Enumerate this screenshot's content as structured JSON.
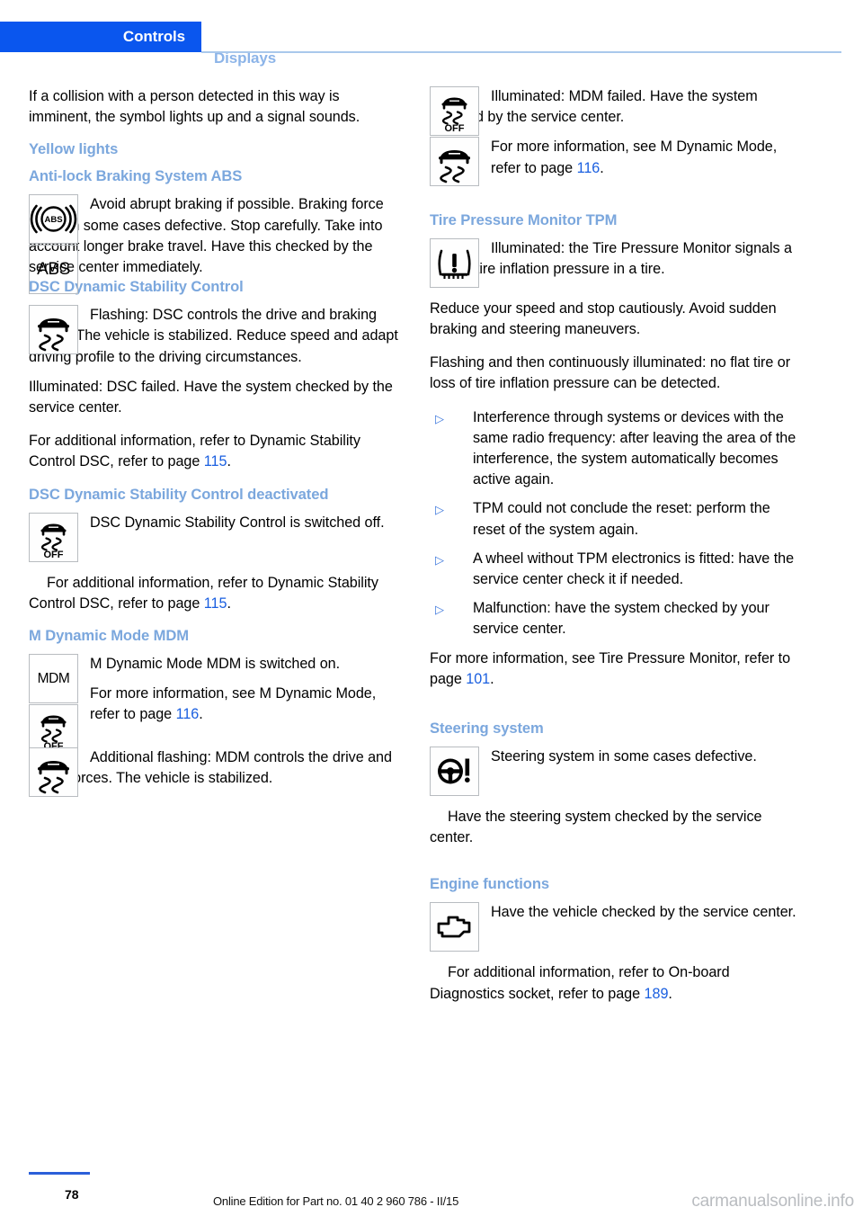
{
  "header": {
    "active_tab": "Controls",
    "inactive_tab": "Displays",
    "accent_blue": "#0a56ee",
    "heading_blue": "#7ba7dd",
    "link_blue": "#1a5fe0"
  },
  "left_column": {
    "intro": "If a collision with a person detected in this way is imminent, the symbol lights up and a signal sounds.",
    "yellow_lights_heading": "Yellow lights",
    "abs": {
      "heading": "Anti-lock Braking System ABS",
      "icon_1": "abs-circle-icon",
      "icon_2_label": "ABS",
      "body": "Avoid abrupt braking if possible. Braking force boost in some cases defective. Stop carefully. Take into account longer brake travel. Have this checked by the service center immediately."
    },
    "dsc": {
      "heading": "DSC Dynamic Stability Control",
      "icon": "car-skid-icon",
      "body_1": "Flashing: DSC controls the drive and braking forces. The vehicle is stabilized. Reduce speed and adapt driving profile to the driving circumstances.",
      "body_2": "Illuminated: DSC failed. Have the system checked by the service center.",
      "body_3_pre": "For additional information, refer to Dynamic Stability Control DSC, refer to page ",
      "body_3_page": "115",
      "body_3_post": "."
    },
    "dsc_off": {
      "heading": "DSC Dynamic Stability Control deactivated",
      "icon": "car-skid-off-icon",
      "body_1": "DSC Dynamic Stability Control is switched off.",
      "body_2_pre": "For additional information, refer to Dynamic Stability Control DSC, refer to page ",
      "body_2_page": "115",
      "body_2_post": "."
    },
    "mdm": {
      "heading": "M Dynamic Mode MDM",
      "icon_1_label": "MDM",
      "icon_2": "car-skid-off-icon",
      "body_1": "M Dynamic Mode MDM is switched on.",
      "body_2_pre": "For more information, see M Dynamic Mode, refer to page ",
      "body_2_page": "116",
      "body_2_post": ".",
      "icon_3": "car-skid-icon",
      "body_3": "Additional flashing: MDM controls the drive and brake forces. The vehicle is stabilized."
    }
  },
  "right_column": {
    "mdm_failed": {
      "icon_1": "car-skid-off-icon",
      "icon_2": "car-skid-icon",
      "body_1": "Illuminated: MDM failed. Have the system checked by the service center.",
      "body_2_pre": "For more information, see M Dynamic Mode, refer to page ",
      "body_2_page": "116",
      "body_2_post": "."
    },
    "tpm": {
      "heading": "Tire Pressure Monitor TPM",
      "icon": "tire-pressure-warning-icon",
      "body_1": "Illuminated: the Tire Pressure Monitor signals a loss of tire inflation pressure in a tire.",
      "body_2": "Reduce your speed and stop cautiously. Avoid sudden braking and steering maneuvers.",
      "body_3": "Flashing and then continuously illuminated: no flat tire or loss of tire inflation pressure can be detected.",
      "bullets": [
        "Interference through systems or devices with the same radio frequency: after leaving the area of the interference, the system automatically becomes active again.",
        "TPM could not conclude the reset: perform the reset of the system again.",
        "A wheel without TPM electronics is fitted: have the service center check it if needed.",
        "Malfunction: have the system checked by your service center."
      ],
      "bullet_marker": "▷",
      "body_4_pre": "For more information, see Tire Pressure Monitor, refer to page ",
      "body_4_page": "101",
      "body_4_post": "."
    },
    "steering": {
      "heading": "Steering system",
      "icon": "steering-wheel-warning-icon",
      "body_1": "Steering system in some cases defective.",
      "body_2": "Have the steering system checked by the service center."
    },
    "engine": {
      "heading": "Engine functions",
      "icon": "engine-check-icon",
      "body_1": "Have the vehicle checked by the service center.",
      "body_2_pre": "For additional information, refer to On-board Diagnostics socket, refer to page ",
      "body_2_page": "189",
      "body_2_post": "."
    }
  },
  "footer": {
    "page_number": "78",
    "edition": "Online Edition for Part no. 01 40 2 960 786 - II/15",
    "watermark": "carmanualsonline.info"
  }
}
